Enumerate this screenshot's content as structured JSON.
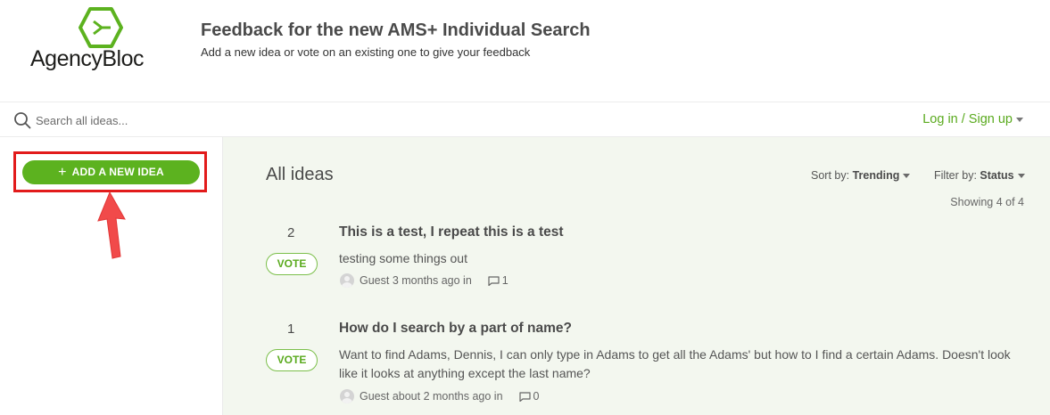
{
  "header": {
    "logo_text": "AgencyBloc",
    "title": "Feedback for the new AMS+ Individual Search",
    "subtitle": "Add a new idea or vote on an existing one to give your feedback"
  },
  "search": {
    "placeholder": "Search all ideas...",
    "value": ""
  },
  "auth": {
    "login_label": "Log in / Sign up"
  },
  "sidebar": {
    "add_idea_label": "ADD A NEW IDEA"
  },
  "main": {
    "heading": "All ideas",
    "sort_prefix": "Sort by:",
    "sort_value": "Trending",
    "filter_prefix": "Filter by:",
    "filter_value": "Status",
    "showing": "Showing 4 of 4",
    "ideas": [
      {
        "votes": "2",
        "vote_label": "VOTE",
        "title": "This is a test, I repeat this is a test",
        "description": "testing some things out",
        "meta": "Guest 3 months ago in",
        "comments": "1"
      },
      {
        "votes": "1",
        "vote_label": "VOTE",
        "title": "How do I search by a part of name?",
        "description": "Want to find Adams, Dennis, I can only type in Adams to get all the Adams' but how to I find a certain Adams. Doesn't look like it looks at anything except the last name?",
        "meta": "Guest about 2 months ago in",
        "comments": "0"
      }
    ]
  },
  "colors": {
    "brand_green": "#5cb21f",
    "highlight_red": "#e21b1b",
    "main_bg": "#f3f7ef"
  },
  "icons": [
    "hexagon-logo-icon",
    "search-icon",
    "chevron-down-icon",
    "plus-icon",
    "avatar-icon",
    "comment-icon",
    "red-arrow-annotation"
  ]
}
